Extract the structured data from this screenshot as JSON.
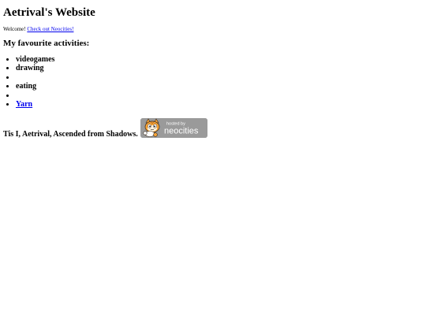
{
  "page": {
    "title": "Aetrival's Website",
    "welcome_text": "Welcome! ",
    "welcome_link": "Check out Neocities!",
    "activities_heading": "My favourite activities:",
    "activities": [
      "videogames",
      "drawing",
      "",
      "eating",
      "",
      "Yarn"
    ],
    "signature": "Tis I, Aetrival, Ascended from Shadows.",
    "badge": {
      "top_text": "hosted by",
      "brand_text": "neocities",
      "icon": "neocities-cat-icon"
    }
  },
  "colors": {
    "link": "#0000ee",
    "badge_bg": "#9a9a9a"
  }
}
